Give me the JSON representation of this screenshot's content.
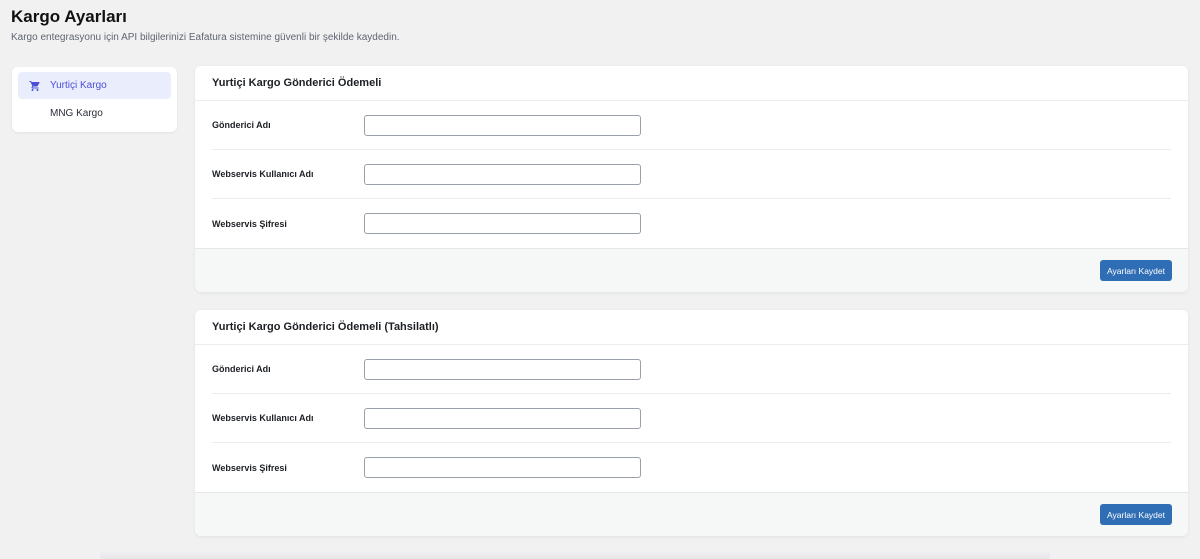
{
  "header": {
    "title": "Kargo Ayarları",
    "subtitle": "Kargo entegrasyonu için API bilgilerinizi Eafatura sistemine güvenli bir şekilde kaydedin."
  },
  "sidebar": {
    "items": [
      {
        "label": "Yurtiçi Kargo",
        "icon": "cart-icon",
        "active": true
      },
      {
        "label": "MNG Kargo",
        "active": false
      }
    ]
  },
  "cards": [
    {
      "title": "Yurtiçi Kargo Gönderici Ödemeli",
      "fields": [
        {
          "label": "Gönderici Adı",
          "value": ""
        },
        {
          "label": "Webservis Kullanıcı Adı",
          "value": ""
        },
        {
          "label": "Webservis Şifresi",
          "value": ""
        }
      ],
      "save_label": "Ayarları Kaydet"
    },
    {
      "title": "Yurtiçi Kargo Gönderici Ödemeli (Tahsilatlı)",
      "fields": [
        {
          "label": "Gönderici Adı",
          "value": ""
        },
        {
          "label": "Webservis Kullanıcı Adı",
          "value": ""
        },
        {
          "label": "Webservis Şifresi",
          "value": ""
        }
      ],
      "save_label": "Ayarları Kaydet"
    }
  ],
  "colors": {
    "accent": "#4c4fd6",
    "active_bg": "#eaedfb",
    "button": "#2f6db5",
    "page_bg": "#f1f1f2"
  }
}
